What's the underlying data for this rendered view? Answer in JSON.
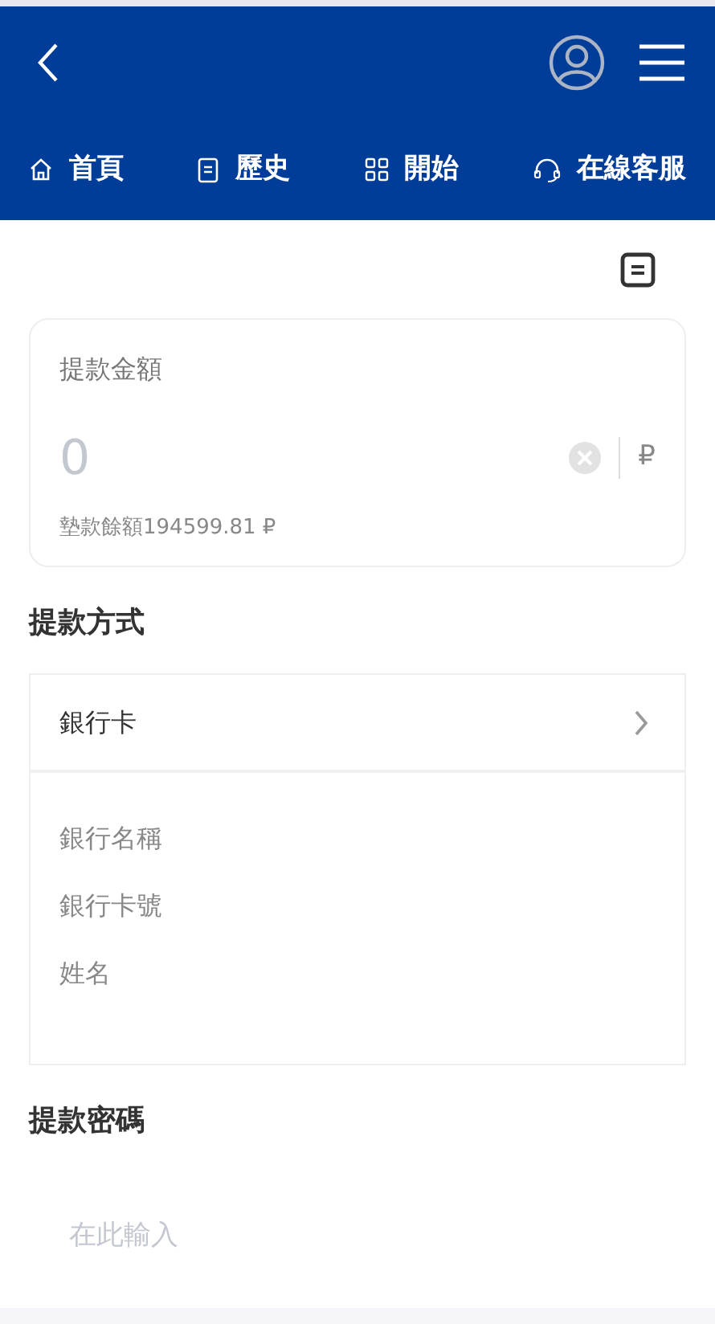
{
  "nav_tabs": [
    {
      "label": "首頁"
    },
    {
      "label": "歷史"
    },
    {
      "label": "開始"
    },
    {
      "label": "在線客服"
    }
  ],
  "amount": {
    "label": "提款金額",
    "placeholder": "0",
    "currency": "₽",
    "balance": "墊款餘額194599.81 ₽"
  },
  "method": {
    "heading": "提款方式",
    "selector": "銀行卡",
    "fields": [
      {
        "placeholder": "銀行名稱"
      },
      {
        "placeholder": "銀行卡號"
      },
      {
        "placeholder": "姓名"
      }
    ]
  },
  "password": {
    "heading": "提款密碼",
    "placeholder": "在此輸入"
  }
}
